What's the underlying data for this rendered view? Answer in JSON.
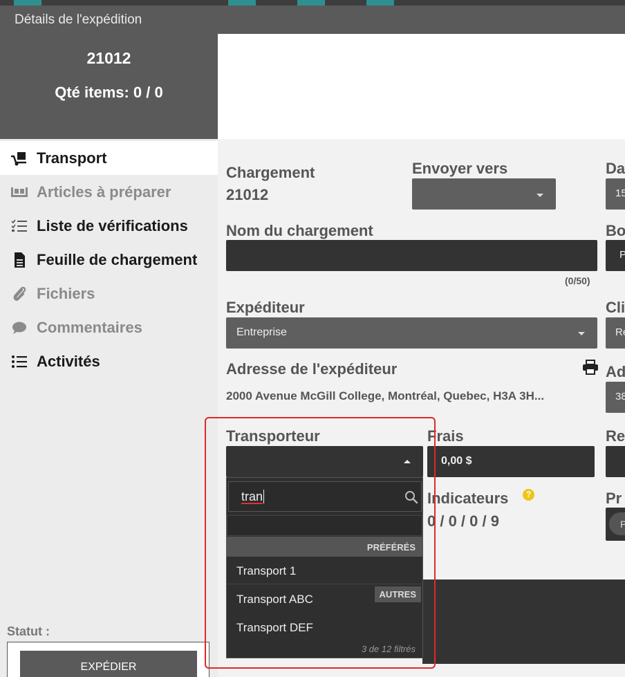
{
  "window": {
    "title": "Détails de l'expédition"
  },
  "colors": {
    "dark_panel": "#5a5a5a",
    "field_bg": "#333333",
    "accent_red": "#e02828",
    "help_yellow": "#f0c419"
  },
  "shipment": {
    "id": "21012",
    "qty_label": "Qté items: 0 / 0"
  },
  "nav": {
    "items": [
      {
        "label": "Transport",
        "icon": "dolly-icon",
        "active": true
      },
      {
        "label": "Articles à préparer",
        "icon": "pallet-icon",
        "disabled": true
      },
      {
        "label": "Liste de vérifications",
        "icon": "checklist-icon"
      },
      {
        "label": "Feuille de chargement",
        "icon": "document-icon"
      },
      {
        "label": "Fichiers",
        "icon": "paperclip-icon",
        "disabled": true
      },
      {
        "label": "Commentaires",
        "icon": "comment-icon",
        "disabled": true
      },
      {
        "label": "Activités",
        "icon": "list-icon"
      }
    ]
  },
  "status": {
    "label": "Statut :",
    "button": "EXPÉDIER"
  },
  "form": {
    "chargement_label": "Chargement",
    "chargement_value": "21012",
    "envoyer_label": "Envoyer vers",
    "envoyer_value": "",
    "date_label": "Da",
    "date_value": "15",
    "nom_label": "Nom du chargement",
    "nom_value": "",
    "nom_counter": "(0/50)",
    "bo_label": "Bo",
    "bo_value": "P",
    "expediteur_label": "Expéditeur",
    "expediteur_value": "Entreprise",
    "client_label": "Cli",
    "client_value": "Re",
    "adresse_label": "Adresse de l'expéditeur",
    "adresse_value": "2000 Avenue McGill College, Montréal, Quebec, H3A 3H...",
    "adresse_right_label": "Ad",
    "adresse_right_value": "38",
    "transporteur_label": "Transporteur",
    "transporteur_value": "",
    "frais_label": "Frais",
    "frais_value": "0,00 $",
    "re_label": "Re",
    "indicateurs_label": "Indicateurs",
    "indicateurs_value": "0 / 0 / 0 / 9",
    "pr_label": "Pr",
    "pr_toggle": "P"
  },
  "dropdown": {
    "search_value": "tran",
    "group_preferes": "PRÉFÉRÉS",
    "group_autres": "AUTRES",
    "items": [
      "Transport 1",
      "Transport ABC",
      "Transport DEF"
    ],
    "footer": "3 de 12 filtrés"
  }
}
